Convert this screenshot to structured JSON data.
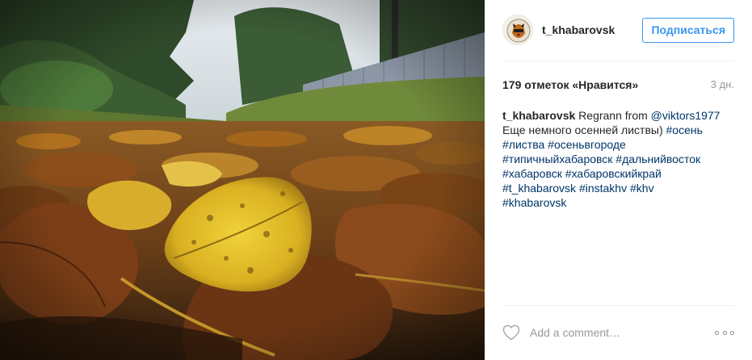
{
  "post": {
    "username": "t_khabarovsk",
    "follow_label": "Подписаться",
    "likes_text": "179 отметок «Нравится»",
    "time_text": "3 дн.",
    "caption": {
      "user": "t_khabarovsk",
      "text_1": "Regrann from",
      "mention": "@viktors1977",
      "text_2": "Еще немного осенней листвы)",
      "hashtags": [
        "#осень",
        "#листва",
        "#осеньвгороде",
        "#типичныйхабаровск",
        "#дальнийвосток",
        "#хабаровск",
        "#хабаровскийкрай",
        "#t_khabarovsk",
        "#instakhv",
        "#khv",
        "#khabarovsk"
      ]
    },
    "comment_placeholder": "Add a comment…",
    "icons": {
      "like": "heart-outline-icon",
      "more": "more-options-icon",
      "avatar": "profile-avatar"
    },
    "colors": {
      "accent": "#3897f0",
      "hashtag": "#003569",
      "muted": "#999999"
    }
  }
}
